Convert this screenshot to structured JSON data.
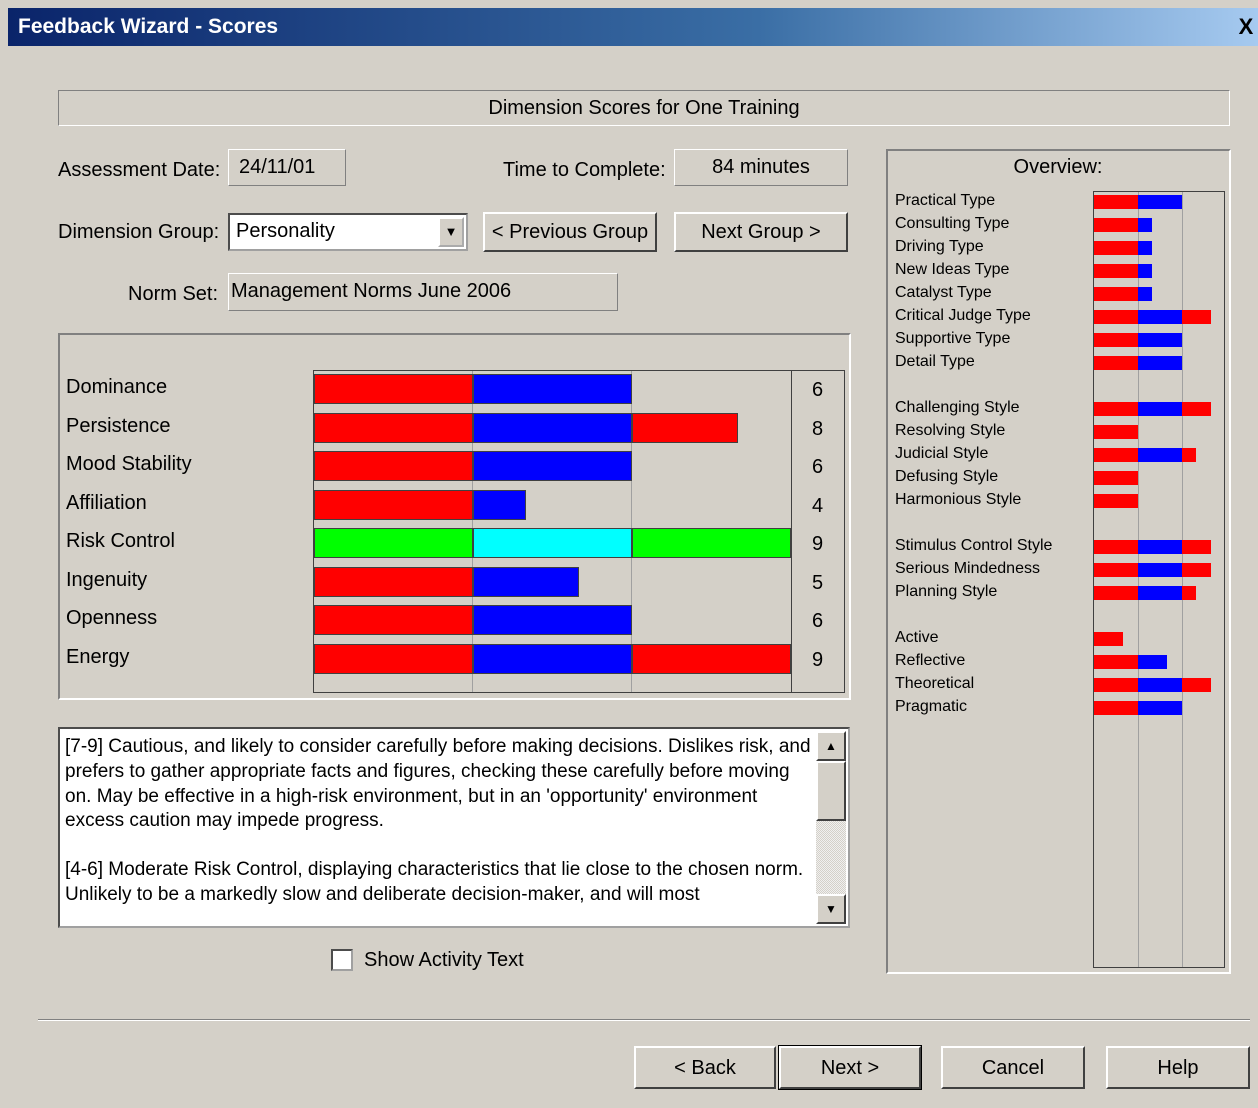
{
  "window": {
    "title": "Feedback Wizard - Scores",
    "close_label": "X"
  },
  "heading": "Dimension Scores for One Training",
  "assessment": {
    "label": "Assessment Date:",
    "value": "24/11/01"
  },
  "time": {
    "label": "Time to Complete:",
    "value": "84 minutes"
  },
  "dimension_group": {
    "label": "Dimension Group:",
    "selected": "Personality"
  },
  "buttons": {
    "previous_group": "< Previous Group",
    "next_group": "Next Group >",
    "back": "< Back",
    "next": "Next >",
    "cancel": "Cancel",
    "help": "Help"
  },
  "norm_set": {
    "label": "Norm Set:",
    "value": "Management Norms June 2006"
  },
  "colors": {
    "red": "#ff0000",
    "blue": "#0000ff",
    "green": "#00ff00",
    "cyan": "#00ffff"
  },
  "scores": [
    {
      "label": "Dominance",
      "score": "6",
      "selected": false
    },
    {
      "label": "Persistence",
      "score": "8",
      "selected": false
    },
    {
      "label": "Mood Stability",
      "score": "6",
      "selected": false
    },
    {
      "label": "Affiliation",
      "score": "4",
      "selected": false
    },
    {
      "label": "Risk Control",
      "score": "9",
      "selected": true
    },
    {
      "label": "Ingenuity",
      "score": "5",
      "selected": false
    },
    {
      "label": "Openness",
      "score": "6",
      "selected": false
    },
    {
      "label": "Energy",
      "score": "9",
      "selected": false
    }
  ],
  "description": {
    "paragraphs": [
      "[7-9] Cautious, and likely to consider carefully before making decisions. Dislikes risk, and prefers to gather appropriate facts and figures, checking these carefully before moving on. May be effective in a high-risk environment, but in an 'opportunity' environment excess caution may impede progress.",
      "[4-6] Moderate Risk Control, displaying characteristics that lie close to the chosen norm. Unlikely to be a markedly slow and deliberate decision-maker, and will most"
    ]
  },
  "show_activity_text": {
    "label": "Show Activity Text",
    "checked": false
  },
  "overview": {
    "title": "Overview:",
    "groups": [
      [
        {
          "label": "Practical Type",
          "score": 6
        },
        {
          "label": "Consulting Type",
          "score": 4
        },
        {
          "label": "Driving  Type",
          "score": 4
        },
        {
          "label": "New Ideas Type",
          "score": 4
        },
        {
          "label": "Catalyst Type",
          "score": 4
        },
        {
          "label": "Critical Judge Type",
          "score": 8
        },
        {
          "label": "Supportive Type",
          "score": 6
        },
        {
          "label": "Detail Type",
          "score": 6
        }
      ],
      [
        {
          "label": "Challenging Style",
          "score": 8
        },
        {
          "label": "Resolving Style",
          "score": 3
        },
        {
          "label": "Judicial Style",
          "score": 7
        },
        {
          "label": "Defusing Style",
          "score": 3
        },
        {
          "label": "Harmonious Style",
          "score": 3
        }
      ],
      [
        {
          "label": "Stimulus Control Style",
          "score": 8
        },
        {
          "label": "Serious Mindedness",
          "score": 8
        },
        {
          "label": "Planning Style",
          "score": 7
        }
      ],
      [
        {
          "label": "Active",
          "score": 2
        },
        {
          "label": "Reflective",
          "score": 5
        },
        {
          "label": "Theoretical",
          "score": 8
        },
        {
          "label": "Pragmatic",
          "score": 6
        }
      ]
    ]
  }
}
